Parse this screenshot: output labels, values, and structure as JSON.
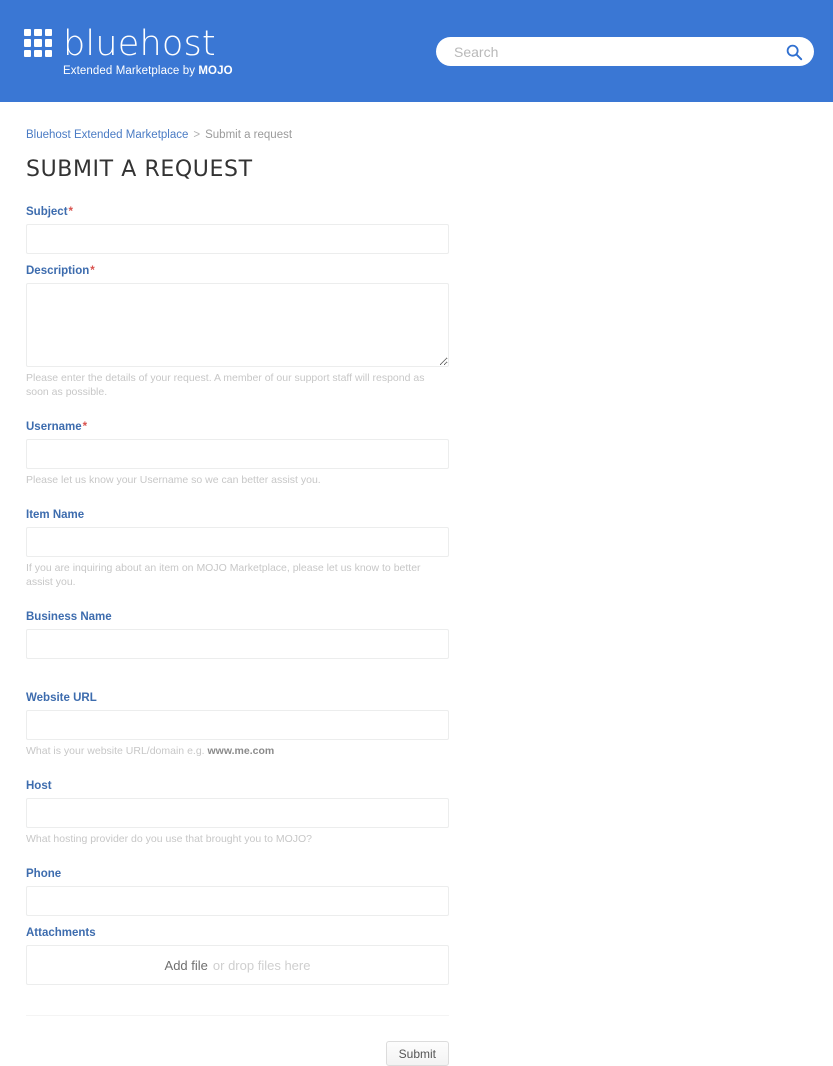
{
  "header": {
    "brand_name": "bluehost",
    "brand_tagline_prefix": "Extended Marketplace by ",
    "brand_tagline_strong": "MOJO",
    "logo_icon": "grid-3x3-icon",
    "search": {
      "placeholder": "Search",
      "value": "",
      "icon": "search-icon"
    },
    "accent_color": "#3a77d4"
  },
  "breadcrumb": {
    "home_label": "Bluehost Extended Marketplace",
    "separator": ">",
    "current_label": "Submit a request"
  },
  "page": {
    "title": "SUBMIT A REQUEST"
  },
  "form": {
    "required_marker": "*",
    "fields": {
      "subject": {
        "label": "Subject",
        "value": "",
        "hint": ""
      },
      "description": {
        "label": "Description",
        "value": "",
        "hint": "Please enter the details of your request. A member of our support staff will respond as soon as possible."
      },
      "username": {
        "label": "Username",
        "value": "",
        "hint": "Please let us know your Username so we can better assist you."
      },
      "item_name": {
        "label": "Item Name",
        "value": "",
        "hint": "If you are inquiring about an item on MOJO Marketplace, please let us know to better assist you."
      },
      "business_name": {
        "label": "Business Name",
        "value": "",
        "hint": ""
      },
      "website_url": {
        "label": "Website URL",
        "value": "",
        "hint_prefix": "What is your website URL/domain e.g. ",
        "hint_strong": "www.me.com"
      },
      "host": {
        "label": "Host",
        "value": "",
        "hint": "What hosting provider do you use that brought you to MOJO?"
      },
      "phone": {
        "label": "Phone",
        "value": "",
        "hint": ""
      },
      "attachments": {
        "label": "Attachments",
        "add_file_label": "Add file",
        "drop_label": "or drop files here"
      }
    },
    "submit_label": "Submit",
    "label_color": "#3d6cae",
    "required_color": "#d9534f"
  }
}
